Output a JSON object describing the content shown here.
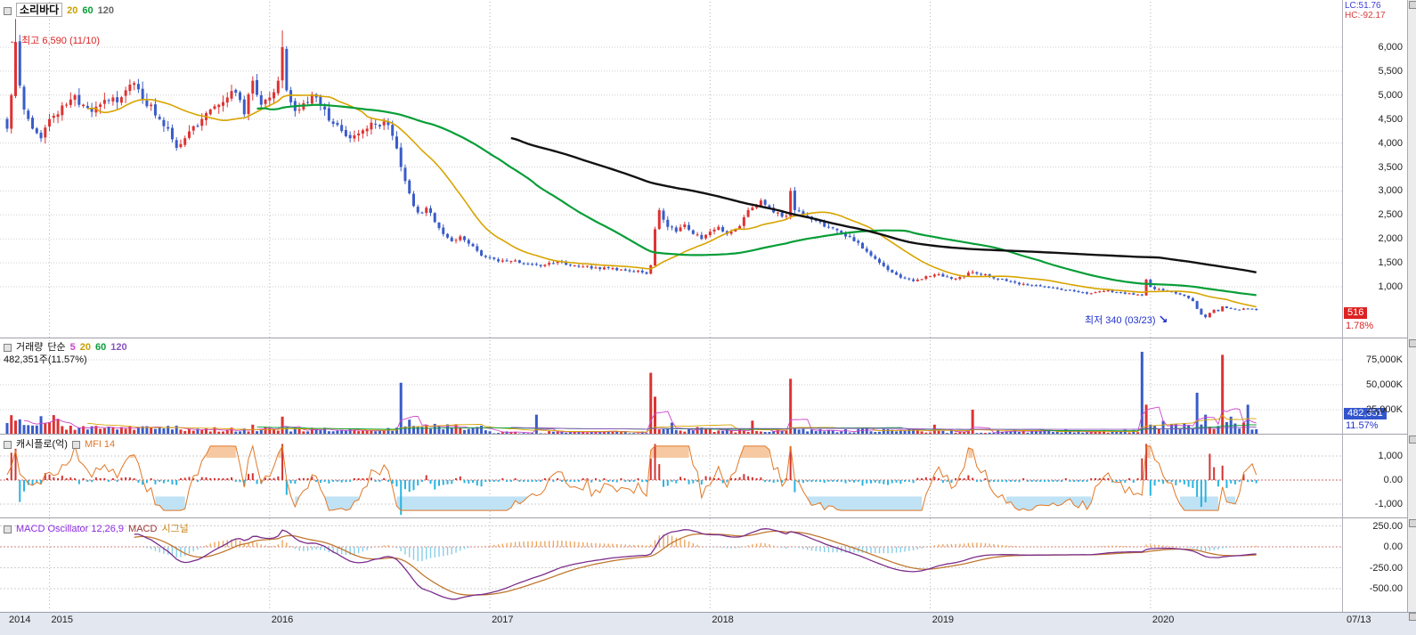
{
  "price_panel": {
    "legend": {
      "title": "소리바다",
      "ma20": "20",
      "ma60": "60",
      "ma120": "120"
    },
    "high_label": "최고 6,590 (11/10)",
    "low_label": "최저 340 (03/23)",
    "badge": "516",
    "badge_pct": "1.78%",
    "lc": "LC:51.76",
    "hc": "HC:-92.17"
  },
  "volume_panel": {
    "legend": {
      "title": "거래량",
      "type": "단순",
      "p5": "5",
      "p20": "20",
      "p60": "60",
      "p120": "120"
    },
    "current": "482,351주(11.57%)",
    "badge": "482,351",
    "badge_pct": "11.57%"
  },
  "cashflow_panel": {
    "legend": {
      "title": "캐시플로(억)",
      "mfi": "MFI 14"
    }
  },
  "macd_panel": {
    "legend": {
      "osc": "MACD Oscillator 12,26,9",
      "macd": "MACD",
      "signal": "시그널"
    }
  },
  "x_axis": {
    "end_label": "07/13"
  },
  "colors": {
    "up": "#dd3333",
    "down": "#3a5cc8",
    "ma20": "#d8a400",
    "ma60": "#089e38",
    "ma120": "#111111",
    "vol5": "#cc44cc",
    "vol20": "#d8a400",
    "vol60": "#089e38",
    "vol120": "#8855bb",
    "cf_pos": "#d23333",
    "cf_neg": "#2ab4e0",
    "mfi": "#e07828",
    "mfi_fill_hi": "#f6c9a2",
    "mfi_fill_lo": "#bfe2f4",
    "osc_pos": "#eda75f",
    "osc_neg": "#86cfe8",
    "macd_line": "#7b2d8b",
    "signal_line": "#c07830",
    "grid": "#cfcfcf",
    "vgrid": "#b4b4bc",
    "badge_price_bg": "#dd2222",
    "badge_vol_bg": "#3355cc",
    "annotation_high": "#dd2222",
    "annotation_low": "#2233cc",
    "legend_osc": "#8a2be2",
    "legend_macd": "#993333",
    "legend_signal": "#cc8822",
    "lc_color": "#3b3bd6",
    "hc_color": "#d63b3b"
  },
  "chart_data": {
    "type": "candlestick",
    "timeframe": "weekly",
    "symbol": "소리바다",
    "bars": 296,
    "seed": 11,
    "first_open": 4500,
    "ma_periods": [
      20,
      60,
      120
    ],
    "volume_ma_periods": [
      5,
      20,
      60,
      120
    ],
    "macd_params": [
      12,
      26,
      9
    ],
    "mfi_period": 14,
    "high_point": {
      "bar": 2,
      "value": 6590,
      "date": "11/10"
    },
    "low_point": {
      "bar": 283,
      "value": 340,
      "date": "03/23"
    },
    "last": {
      "close": 516,
      "change_pct": 1.78,
      "volume_shares": 482351,
      "volume_pct": 11.57
    },
    "extra_wicks": [
      [
        65,
        6350
      ]
    ],
    "price_keyframes": [
      [
        0,
        4300
      ],
      [
        1,
        5000
      ],
      [
        2,
        6100
      ],
      [
        3,
        5200
      ],
      [
        4,
        4700
      ],
      [
        6,
        4300
      ],
      [
        8,
        4100
      ],
      [
        10,
        4500
      ],
      [
        12,
        4600
      ],
      [
        14,
        4800
      ],
      [
        16,
        5000
      ],
      [
        18,
        4800
      ],
      [
        20,
        4650
      ],
      [
        23,
        4900
      ],
      [
        26,
        4850
      ],
      [
        28,
        5100
      ],
      [
        30,
        5250
      ],
      [
        32,
        4900
      ],
      [
        34,
        4800
      ],
      [
        36,
        4500
      ],
      [
        38,
        4300
      ],
      [
        40,
        3900
      ],
      [
        42,
        4100
      ],
      [
        44,
        4350
      ],
      [
        46,
        4500
      ],
      [
        48,
        4700
      ],
      [
        50,
        4800
      ],
      [
        52,
        4950
      ],
      [
        54,
        5050
      ],
      [
        56,
        4600
      ],
      [
        58,
        5300
      ],
      [
        60,
        4800
      ],
      [
        62,
        4950
      ],
      [
        64,
        5300
      ],
      [
        65,
        6000
      ],
      [
        66,
        5100
      ],
      [
        67,
        4850
      ],
      [
        69,
        4700
      ],
      [
        71,
        4850
      ],
      [
        73,
        4950
      ],
      [
        75,
        4700
      ],
      [
        77,
        4400
      ],
      [
        79,
        4250
      ],
      [
        81,
        4100
      ],
      [
        83,
        4200
      ],
      [
        85,
        4300
      ],
      [
        87,
        4400
      ],
      [
        89,
        4450
      ],
      [
        91,
        4150
      ],
      [
        93,
        3500
      ],
      [
        95,
        2950
      ],
      [
        97,
        2550
      ],
      [
        99,
        2650
      ],
      [
        101,
        2350
      ],
      [
        103,
        2100
      ],
      [
        105,
        1950
      ],
      [
        107,
        2050
      ],
      [
        109,
        1900
      ],
      [
        111,
        1750
      ],
      [
        113,
        1620
      ],
      [
        115,
        1580
      ],
      [
        118,
        1540
      ],
      [
        121,
        1500
      ],
      [
        124,
        1470
      ],
      [
        127,
        1460
      ],
      [
        130,
        1520
      ],
      [
        133,
        1450
      ],
      [
        136,
        1420
      ],
      [
        139,
        1400
      ],
      [
        142,
        1390
      ],
      [
        145,
        1360
      ],
      [
        148,
        1320
      ],
      [
        150,
        1300
      ],
      [
        151,
        1270
      ],
      [
        152,
        1450
      ],
      [
        153,
        2200
      ],
      [
        154,
        2600
      ],
      [
        155,
        2400
      ],
      [
        156,
        2250
      ],
      [
        158,
        2150
      ],
      [
        160,
        2300
      ],
      [
        162,
        2100
      ],
      [
        164,
        2000
      ],
      [
        166,
        2150
      ],
      [
        168,
        2250
      ],
      [
        170,
        2100
      ],
      [
        172,
        2200
      ],
      [
        174,
        2450
      ],
      [
        176,
        2650
      ],
      [
        178,
        2800
      ],
      [
        180,
        2650
      ],
      [
        182,
        2550
      ],
      [
        184,
        2480
      ],
      [
        185,
        3000
      ],
      [
        186,
        2600
      ],
      [
        188,
        2500
      ],
      [
        190,
        2400
      ],
      [
        192,
        2350
      ],
      [
        194,
        2250
      ],
      [
        196,
        2180
      ],
      [
        198,
        2050
      ],
      [
        200,
        1950
      ],
      [
        202,
        1800
      ],
      [
        204,
        1650
      ],
      [
        206,
        1500
      ],
      [
        208,
        1350
      ],
      [
        210,
        1250
      ],
      [
        212,
        1180
      ],
      [
        214,
        1120
      ],
      [
        216,
        1160
      ],
      [
        218,
        1220
      ],
      [
        220,
        1260
      ],
      [
        222,
        1210
      ],
      [
        224,
        1170
      ],
      [
        226,
        1220
      ],
      [
        228,
        1310
      ],
      [
        230,
        1260
      ],
      [
        232,
        1210
      ],
      [
        234,
        1160
      ],
      [
        236,
        1120
      ],
      [
        238,
        1090
      ],
      [
        240,
        1060
      ],
      [
        242,
        1030
      ],
      [
        244,
        1010
      ],
      [
        246,
        985
      ],
      [
        248,
        960
      ],
      [
        250,
        935
      ],
      [
        252,
        905
      ],
      [
        254,
        885
      ],
      [
        256,
        865
      ],
      [
        258,
        905
      ],
      [
        260,
        925
      ],
      [
        262,
        885
      ],
      [
        264,
        855
      ],
      [
        266,
        835
      ],
      [
        268,
        820
      ],
      [
        269,
        1150
      ],
      [
        270,
        1000
      ],
      [
        272,
        950
      ],
      [
        274,
        905
      ],
      [
        276,
        860
      ],
      [
        278,
        810
      ],
      [
        280,
        700
      ],
      [
        281,
        540
      ],
      [
        282,
        420
      ],
      [
        283,
        365
      ],
      [
        284,
        455
      ],
      [
        285,
        520
      ],
      [
        286,
        490
      ],
      [
        287,
        590
      ],
      [
        288,
        555
      ],
      [
        290,
        525
      ],
      [
        292,
        545
      ],
      [
        294,
        535
      ],
      [
        295,
        516
      ]
    ],
    "volume_base": [
      [
        0,
        12,
        9000,
        20000
      ],
      [
        13,
        40,
        4000,
        9000
      ],
      [
        41,
        64,
        3000,
        8000
      ],
      [
        65,
        92,
        2500,
        7000
      ],
      [
        93,
        113,
        4000,
        11000
      ],
      [
        114,
        151,
        1200,
        3500
      ],
      [
        152,
        166,
        3000,
        8000
      ],
      [
        167,
        218,
        2000,
        6000
      ],
      [
        219,
        267,
        1500,
        5000
      ],
      [
        268,
        295,
        5000,
        14000
      ]
    ],
    "volume_spikes": [
      [
        2,
        14000
      ],
      [
        5,
        9500
      ],
      [
        40,
        9000
      ],
      [
        58,
        10000
      ],
      [
        65,
        18000
      ],
      [
        93,
        52000
      ],
      [
        95,
        15000
      ],
      [
        125,
        20000
      ],
      [
        152,
        62000
      ],
      [
        153,
        38000
      ],
      [
        157,
        12000
      ],
      [
        176,
        14000
      ],
      [
        185,
        56000
      ],
      [
        219,
        10000
      ],
      [
        228,
        25000
      ],
      [
        268,
        83000
      ],
      [
        269,
        30000
      ],
      [
        281,
        42000
      ],
      [
        283,
        20000
      ],
      [
        287,
        80000
      ],
      [
        289,
        18000
      ],
      [
        293,
        30000
      ]
    ],
    "cashflow_overrides": [
      [
        65,
        1500
      ],
      [
        93,
        -1450
      ],
      [
        152,
        900
      ],
      [
        185,
        1400
      ],
      [
        268,
        900
      ],
      [
        281,
        -700
      ],
      [
        287,
        600
      ]
    ],
    "price_ticks": [
      {
        "v": 6000,
        "t": "6,000"
      },
      {
        "v": 5500,
        "t": "5,500"
      },
      {
        "v": 5000,
        "t": "5,000"
      },
      {
        "v": 4500,
        "t": "4,500"
      },
      {
        "v": 4000,
        "t": "4,000"
      },
      {
        "v": 3500,
        "t": "3,500"
      },
      {
        "v": 3000,
        "t": "3,000"
      },
      {
        "v": 2500,
        "t": "2,500"
      },
      {
        "v": 2000,
        "t": "2,000"
      },
      {
        "v": 1500,
        "t": "1,500"
      },
      {
        "v": 1000,
        "t": "1,000"
      }
    ],
    "volume_ticks": [
      {
        "v": 75000,
        "t": "75,000K"
      },
      {
        "v": 50000,
        "t": "50,000K"
      },
      {
        "v": 25000,
        "t": "25,000K"
      }
    ],
    "cashflow_ticks": [
      {
        "v": 1000,
        "t": "1,000"
      },
      {
        "v": 0,
        "t": "0.00"
      },
      {
        "v": -1000,
        "t": "-1,000"
      }
    ],
    "macd_ticks": [
      {
        "v": 250,
        "t": "250.00"
      },
      {
        "v": 0,
        "t": "0.00"
      },
      {
        "v": -250,
        "t": "-250.00"
      },
      {
        "v": -500,
        "t": "-500.00"
      }
    ],
    "year_ticks": [
      {
        "t": "2014",
        "bar": 0
      },
      {
        "t": "2015",
        "bar": 10
      },
      {
        "t": "2016",
        "bar": 62
      },
      {
        "t": "2017",
        "bar": 114
      },
      {
        "t": "2018",
        "bar": 166
      },
      {
        "t": "2019",
        "bar": 218
      },
      {
        "t": "2020",
        "bar": 270
      }
    ]
  }
}
